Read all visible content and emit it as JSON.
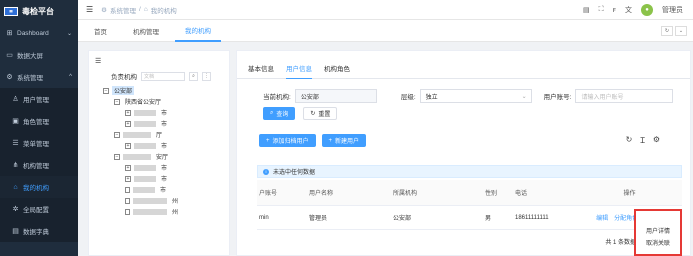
{
  "sidebar": {
    "logo_text": "毒检平台",
    "items": [
      {
        "label": "Dashboard",
        "icon": "grid-icon",
        "caret": "⌄"
      },
      {
        "label": "数据大屏",
        "icon": "monitor-icon",
        "caret": ""
      },
      {
        "label": "系统管理",
        "icon": "gear-icon",
        "caret": "^"
      },
      {
        "label": "用户管理",
        "icon": "user-icon",
        "caret": ""
      },
      {
        "label": "角色管理",
        "icon": "role-icon",
        "caret": ""
      },
      {
        "label": "菜单管理",
        "icon": "menu-icon",
        "caret": ""
      },
      {
        "label": "机构管理",
        "icon": "org-icon",
        "caret": ""
      },
      {
        "label": "我的机构",
        "icon": "home-icon",
        "caret": ""
      },
      {
        "label": "全局配置",
        "icon": "settings-icon",
        "caret": ""
      },
      {
        "label": "数据字典",
        "icon": "dict-icon",
        "caret": ""
      }
    ]
  },
  "navbar": {
    "breadcrumb": [
      "系统管理",
      "/",
      "我的机构"
    ],
    "user_name": "管理员",
    "icons": [
      "doc-icon",
      "fullscreen-icon",
      "font-size-icon",
      "translate-icon"
    ]
  },
  "tags": {
    "items": [
      "首页",
      "机构管理",
      "我的机构"
    ],
    "active": 2
  },
  "tree": {
    "label": "负责机构",
    "search_placeholder": "文档",
    "nodes": [
      {
        "label": "公安部",
        "level": 0,
        "kind": "minus",
        "selected": true
      },
      {
        "label": "陕西省公安厅",
        "level": 1,
        "kind": "minus"
      },
      {
        "label": "市",
        "level": 2,
        "kind": "plus",
        "blur": 22
      },
      {
        "label": "市",
        "level": 2,
        "kind": "plus",
        "blur": 22
      },
      {
        "label": "厅",
        "level": 1,
        "kind": "minus",
        "blur": 28
      },
      {
        "label": "市",
        "level": 2,
        "kind": "plus",
        "blur": 22
      },
      {
        "label": "安厅",
        "level": 1,
        "kind": "minus",
        "blur": 28
      },
      {
        "label": "市",
        "level": 2,
        "kind": "plus",
        "blur": 22
      },
      {
        "label": "市",
        "level": 2,
        "kind": "plus",
        "blur": 22
      },
      {
        "label": "市",
        "level": 2,
        "kind": "file",
        "blur": 22
      },
      {
        "label": "州",
        "level": 2,
        "kind": "file",
        "blur": 34
      },
      {
        "label": "州",
        "level": 2,
        "kind": "file",
        "blur": 34
      }
    ]
  },
  "tabs": {
    "items": [
      "基本信息",
      "用户信息",
      "机构角色"
    ],
    "active": 1
  },
  "form": {
    "org_label": "当前机构:",
    "org_value": "公安部",
    "level_label": "层级:",
    "level_value": "独立",
    "account_label": "用户账号:",
    "account_placeholder": "请输入用户账号",
    "search_btn": "查询",
    "reset_btn": "重置"
  },
  "actions": {
    "add_btn": "添加归档用户",
    "new_btn": "新建用户"
  },
  "alert_text": "未选中任何数据",
  "table": {
    "headers": [
      "户账号",
      "用户名称",
      "所属机构",
      "性别",
      "电话",
      "操作"
    ],
    "rows": [
      {
        "account": "min",
        "name": "管理员",
        "org": "公安部",
        "gender": "男",
        "phone": "18611111111",
        "edit": "编辑",
        "assign": "分配角色",
        "more": "更多"
      }
    ]
  },
  "pager": {
    "total_text": "共 1 条数据",
    "page": "1"
  },
  "dropdown": {
    "items": [
      "用户详情",
      "取消关联"
    ]
  },
  "colors": {
    "primary": "#409eff",
    "sidebar_bg": "#1f2d3d",
    "highlight_border": "#e53935"
  }
}
